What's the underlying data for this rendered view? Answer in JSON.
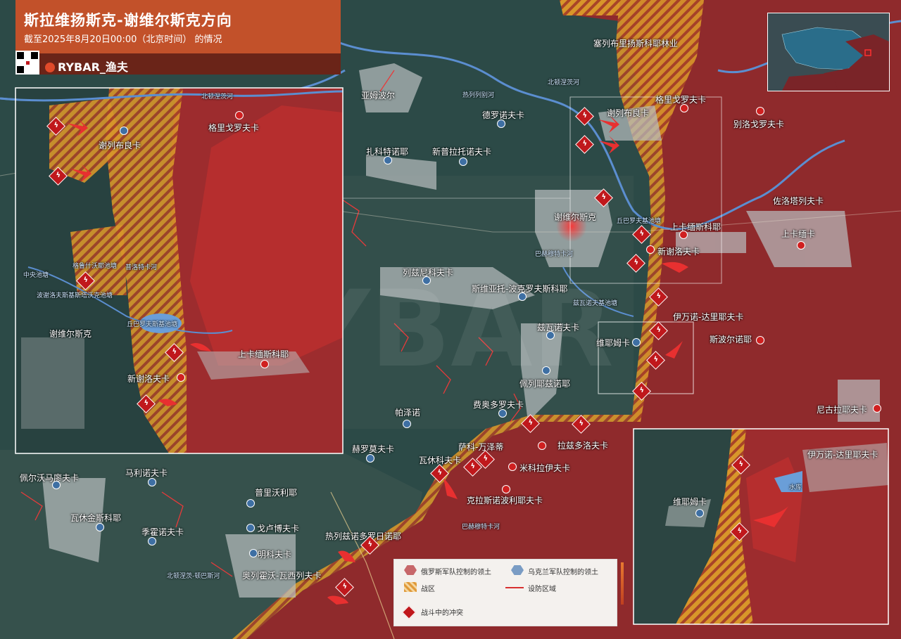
{
  "header": {
    "title": "斯拉维扬斯克-谢维尔斯克方向",
    "subtitle": "截至2025年8月20日00:00（北京时间） 的情况",
    "brand": "RYBAR_渔夫"
  },
  "legend": {
    "russia": "俄罗斯军队控制的领土",
    "ukraine": "乌克兰军队控制的领土",
    "battle_zone": "战区",
    "defense_zone": "设防区域",
    "clash": "战斗中的冲突"
  },
  "colors": {
    "russia": "#b8262a",
    "ukraine": "#3e6fa3",
    "battle": "#d8962a",
    "header": "#c2512a"
  },
  "places": {
    "seversk": "谢维尔斯克",
    "serebryanka": "谢列布良卡",
    "grigorovka": "格里戈罗夫卡",
    "seversk_forest": "塞列布里扬斯科耶林业",
    "yampol": "亚姆波尔",
    "dronovka": "德罗诺夫卡",
    "zakotnoe": "扎科特诺耶",
    "novoselovka": "新普拉托诺夫卡",
    "belogorovka": "别洛戈罗夫卡",
    "zolotarevka": "佐洛塔列夫卡",
    "verkhnekamenka": "上卡缅斯科耶",
    "verkhnekamenka2": "上卡缅卡",
    "novoselovka2": "新谢洛夫卡",
    "ivano_daryevka": "伊万诺-达里耶夫卡",
    "spornoe": "斯波尔诺耶",
    "vyemka": "维耶姆卡",
    "razdolovka": "列兹尼科夫卡",
    "svyato_pokrovskoe": "斯维亚托-波克罗夫斯科耶",
    "zvanovka": "兹瓦诺夫卡",
    "pereezdnoe": "佩列耶兹诺耶",
    "fedorovka": "费奥多罗夫卡",
    "pazeno": "帕泽诺",
    "nikolaevka": "尼古拉耶夫卡",
    "gremyachaya": "赫罗莫夫卡",
    "vasyukovka": "瓦休科夫卡",
    "sakko_vantsetti": "萨科-万泽蒂",
    "razdolovka2": "拉兹多洛夫卡",
    "mikolayevka": "米科拉伊夫卡",
    "kramatorsk_area": "克拉斯诺波利耶夫卡",
    "pervomaisk": "佩尔沃马廖夫卡",
    "malinovka": "马利诺夫卡",
    "vasilkovo": "瓦休金斯科耶",
    "serebrianka2": "季霍诺夫卡",
    "privolie": "普里沃利耶",
    "gorbatovka": "戈卢博夫卡",
    "mikovka": "明科夫卡",
    "hryhorivka": "热列兹诺多罗日诺耶",
    "orekhovo": "奥列霍沃-瓦西列夫卡",
    "inset_seversk": "谢维尔斯克",
    "inset_serebryanka": "谢列布良卡",
    "inset_grigorovka": "格里戈罗夫卡",
    "inset_verkhnekamenka": "上卡缅斯科耶",
    "inset_novoselovka": "新谢洛夫卡",
    "inset2_ivano": "伊万诺-达里耶夫卡",
    "inset2_vyemka": "维耶姆卡"
  },
  "water": {
    "donets_north": "北顿涅茨河",
    "donets_north2": "北顿涅茨河",
    "siverskyi": "热列列别河",
    "bakhmutka": "巴赫穆特卡河",
    "bakhmutka2": "巴赫穆特卡河",
    "reservoir": "丘巴罗夫基池塘",
    "reservoir2": "兹瓦诺夫基池塘",
    "canal": "北顿涅茨-顿巴斯河",
    "inset_ponds1": "格鲁什沃耶池塘",
    "inset_ponds2": "普洛特卡河",
    "inset_ponds3": "中央池塘",
    "inset_ponds4": "波谢洛夫斯基斯塔沃克池塘",
    "inset_reservoir": "丘巴罗夫斯基池塘",
    "inset_donets": "北顿涅茨河",
    "inset2_reservoir": "水库"
  }
}
